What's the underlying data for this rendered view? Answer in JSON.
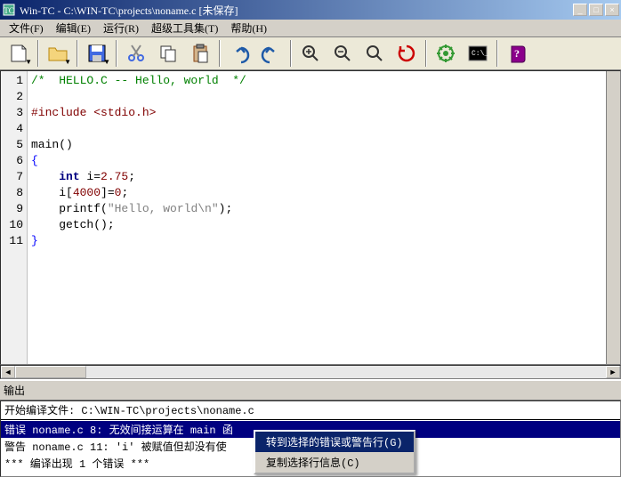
{
  "title": "Win-TC - C:\\WIN-TC\\projects\\noname.c [未保存]",
  "menu": {
    "file": "文件(F)",
    "edit": "编辑(E)",
    "run": "运行(R)",
    "tools": "超级工具集(T)",
    "help": "帮助(H)"
  },
  "code": {
    "lines": [
      "1",
      "2",
      "3",
      "4",
      "5",
      "6",
      "7",
      "8",
      "9",
      "10",
      "11"
    ],
    "l1_comment": "/*  HELLO.C -- Hello, world  */",
    "l3_include": "#include <stdio.h>",
    "l5_main": "main()",
    "l6_brace": "{",
    "l7_indent": "    ",
    "l7_type": "int",
    "l7_var": " i=",
    "l7_val": "2.75",
    "l7_end": ";",
    "l8_indent": "    i[",
    "l8_idx": "4000",
    "l8_rest": "]=",
    "l8_zero": "0",
    "l8_end": ";",
    "l9_indent": "    printf(",
    "l9_str": "\"Hello, world\\n\"",
    "l9_end": ");",
    "l10_indent": "    getch();",
    "l11_brace": "}"
  },
  "output": {
    "title": "输出",
    "line1": "开始编译文件: C:\\WIN-TC\\projects\\noname.c",
    "error": "错误 noname.c 8: 无效间接运算在 main 函",
    "warn": "警告 noname.c 11: 'i' 被赋值但却没有使",
    "summary": "***  编译出现 1 个错误   ***"
  },
  "context_menu": {
    "goto": "转到选择的错误或警告行(G)",
    "copy": "复制选择行信息(C)"
  }
}
